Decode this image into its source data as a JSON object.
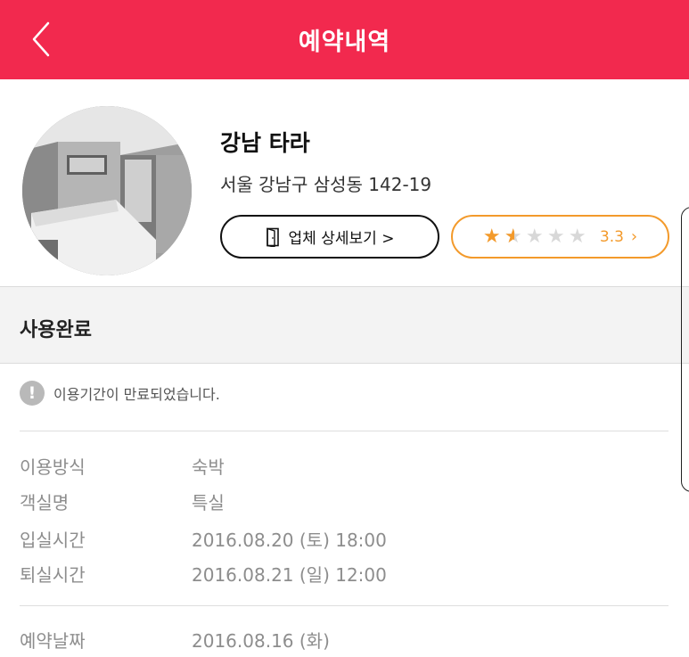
{
  "header": {
    "title": "예약내역"
  },
  "hotel": {
    "name": "강남 타라",
    "address": "서울 강남구 삼성동 142-19",
    "detail_button": "업체 상세보기 >",
    "rating": {
      "value": "3.3",
      "stars": 1.5,
      "max_stars": 5
    }
  },
  "status": {
    "label": "사용완료"
  },
  "notice": {
    "icon": "!",
    "text": "이용기간이 만료되었습니다."
  },
  "info": [
    {
      "label": "이용방식",
      "value": "숙박"
    },
    {
      "label": "객실명",
      "value": "특실"
    },
    {
      "label": "입실시간",
      "value": "2016.08.20 (토) 18:00"
    },
    {
      "label": "퇴실시간",
      "value": "2016.08.21 (일) 12:00"
    }
  ],
  "booking": {
    "label": "예약날짜",
    "value": "2016.08.16 (화)"
  },
  "colors": {
    "brand": "#f2294e",
    "rating": "#f39a2b"
  }
}
